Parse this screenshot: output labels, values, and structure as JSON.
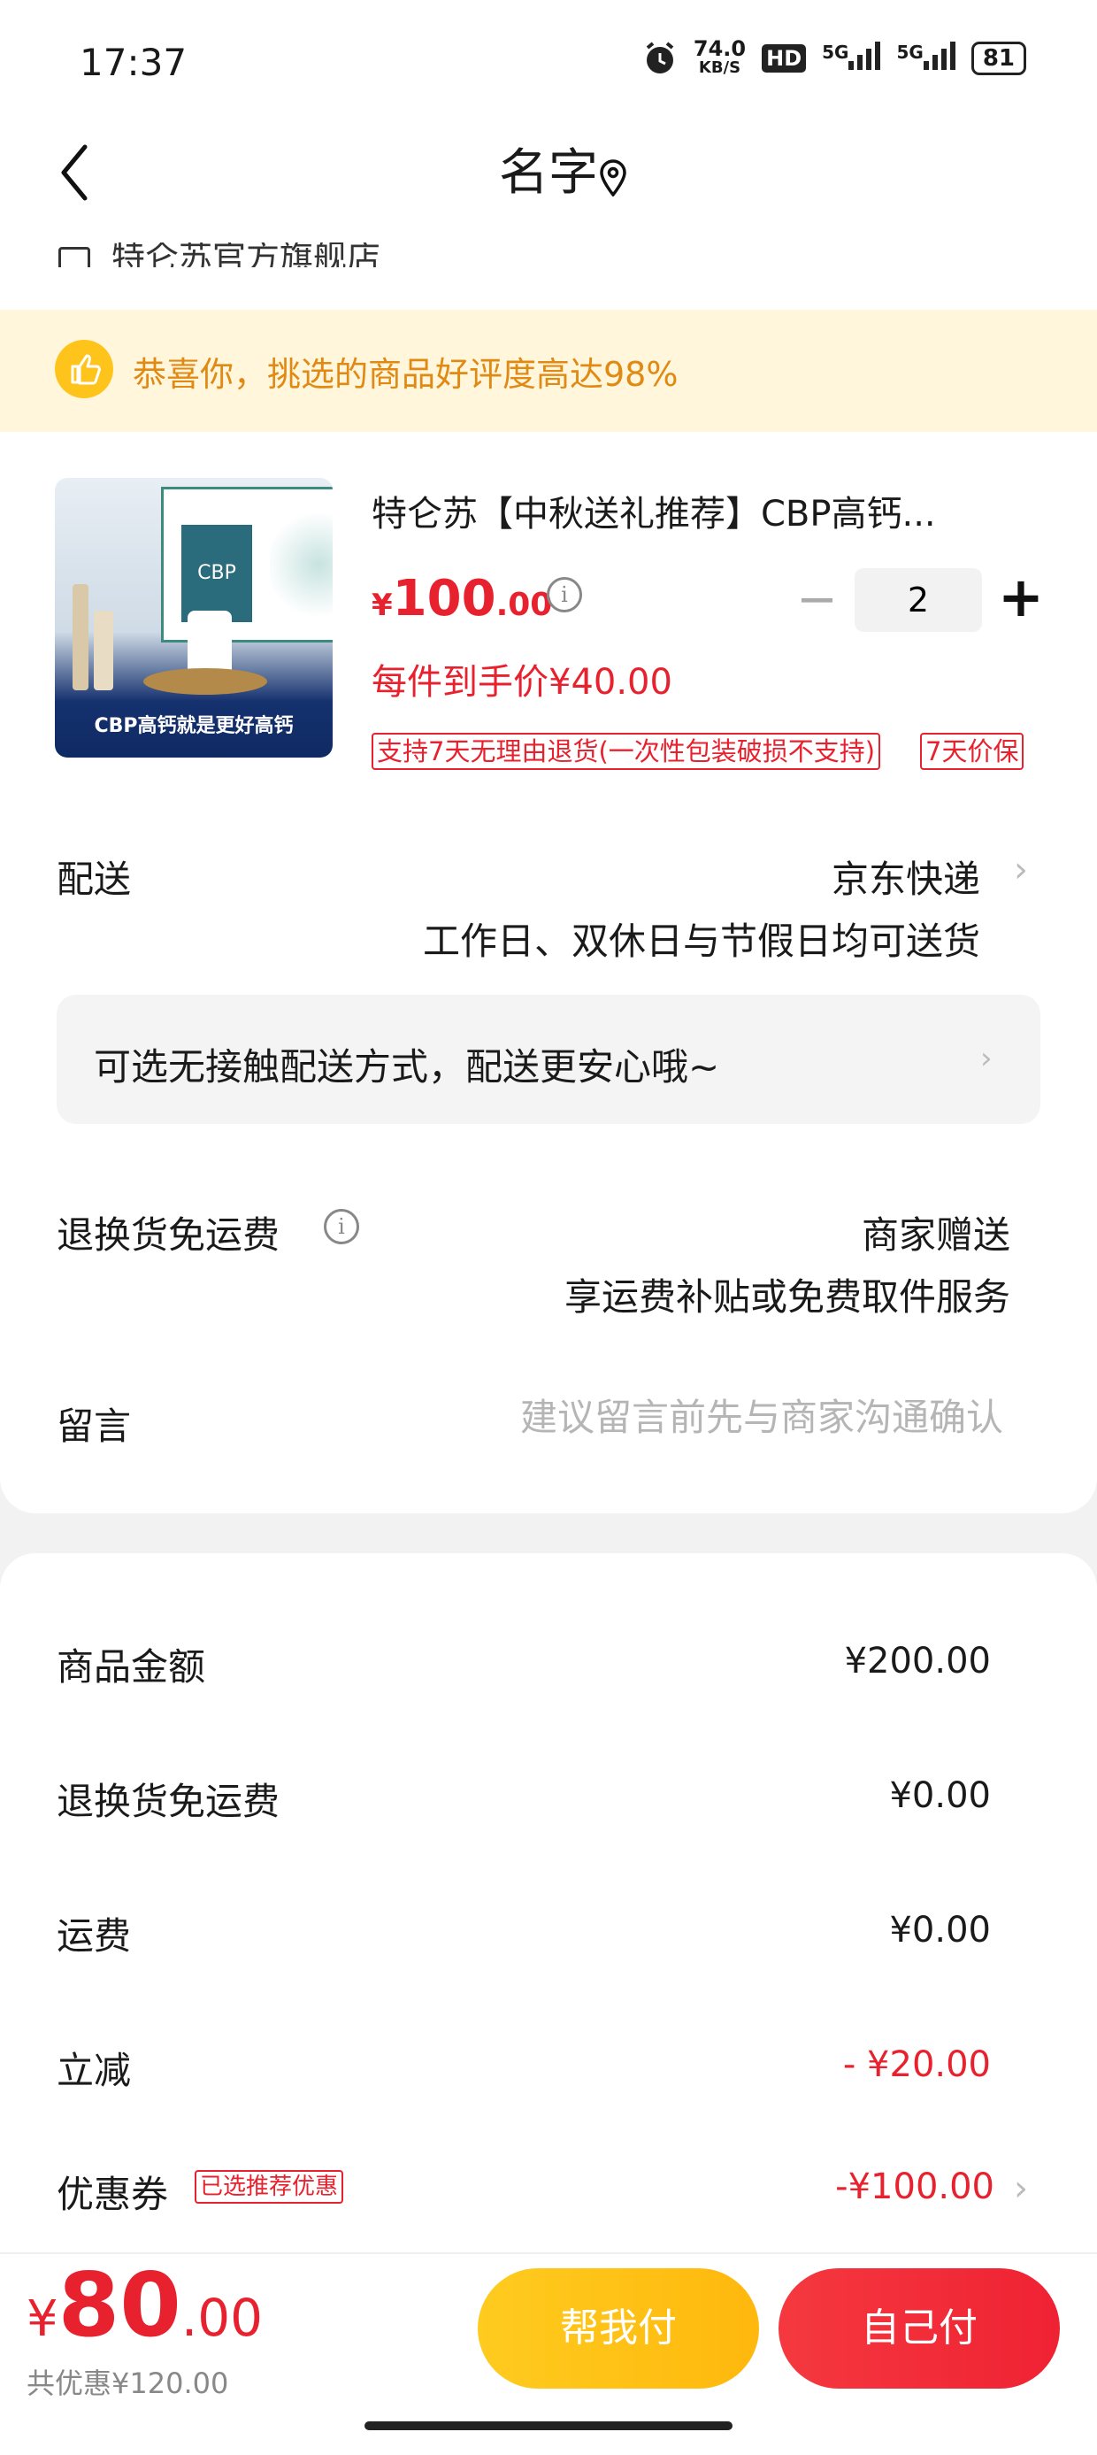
{
  "status_bar": {
    "time": "17:37",
    "net_speed": "74.0",
    "net_unit": "KB/S",
    "hd": "HD",
    "sig1": "5G",
    "sig2": "5G",
    "battery": "81"
  },
  "header": {
    "title": "名字"
  },
  "shop": {
    "name": "特仑苏官方旗舰店"
  },
  "banner": {
    "text": "恭喜你，挑选的商品好评度高达98%"
  },
  "product": {
    "title": "特仑苏【中秋送礼推荐】CBP高钙...",
    "price_yen": "¥",
    "price_int": "100",
    "price_dec": ".00",
    "quantity": "2",
    "unit_price": "每件到手价¥40.00",
    "tag_return": "支持7天无理由退货(一次性包装破损不支持)",
    "tag_price_protect": "7天价保",
    "image_text": "CBP高钙就是更好高钙"
  },
  "delivery": {
    "label": "配送",
    "method": "京东快递",
    "schedule": "工作日、双休日与节假日均可送货",
    "contactless": "可选无接触配送方式，配送更安心哦~"
  },
  "return_shipping": {
    "label": "退换货免运费",
    "value": "商家赠送",
    "desc": "享运费补贴或免费取件服务"
  },
  "message": {
    "label": "留言",
    "placeholder": "建议留言前先与商家沟通确认"
  },
  "summary": [
    {
      "label": "商品金额",
      "value": "¥200.00"
    },
    {
      "label": "退换货免运费",
      "value": "¥0.00"
    },
    {
      "label": "运费",
      "value": "¥0.00"
    },
    {
      "label": "立减",
      "value": "- ¥20.00"
    },
    {
      "label": "优惠券",
      "value": "-¥100.00",
      "tag": "已选推荐优惠"
    }
  ],
  "bottom": {
    "total_yen": "¥",
    "total_int": "80",
    "total_dec": ".00",
    "saved": "共优惠¥120.00",
    "help_pay": "帮我付",
    "self_pay": "自己付"
  },
  "colors": {
    "accent_red": "#e8212e",
    "banner_bg": "#fff6dc",
    "banner_text": "#e08a14",
    "help_button": "#ffc41c",
    "self_button": "#f22c38"
  }
}
